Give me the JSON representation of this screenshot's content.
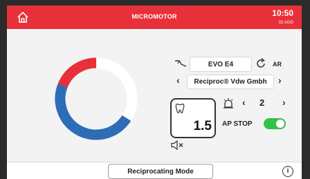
{
  "header": {
    "title": "MICROMOTOR",
    "time": "10:50",
    "date": "02 AGO",
    "bar_color": "#e8303a",
    "home_icon": "home-icon"
  },
  "motor": {
    "file_system": "EVO E4",
    "rotation_label": "AR",
    "manufacturer": "Reciproc® Vdw Gmbh",
    "speed_level": "2",
    "torque": "1.5",
    "apex_stop_label": "AP STOP",
    "apex_stop_enabled": true
  },
  "gauge": {
    "red_fraction": 0.19,
    "blue_fraction": 0.47,
    "red_color": "#e8303a",
    "blue_color": "#2f6cb8",
    "track_color": "#ffffff"
  },
  "footer": {
    "mode_label": "Reciprocating Mode",
    "info_icon": "info-icon"
  }
}
